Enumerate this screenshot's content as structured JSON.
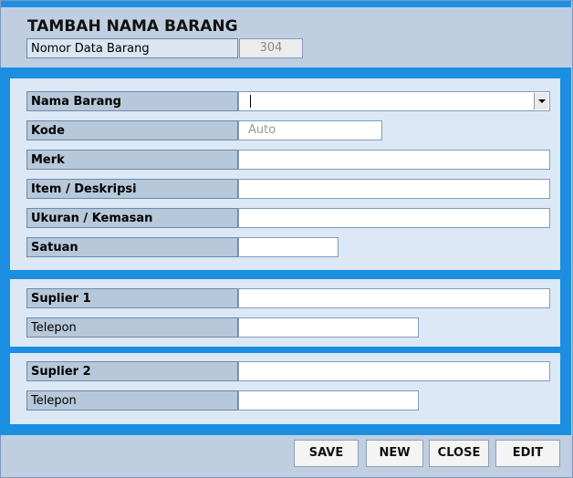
{
  "form": {
    "title": "TAMBAH NAMA BARANG",
    "nomor_label": "Nomor Data Barang",
    "nomor_value": "304"
  },
  "barang": {
    "nama_label": "Nama Barang",
    "nama_value": "",
    "kode_label": "Kode",
    "kode_placeholder": "Auto",
    "merk_label": "Merk",
    "item_label": "Item / Deskripsi",
    "ukuran_label": "Ukuran / Kemasan",
    "satuan_label": "Satuan"
  },
  "suplier1": {
    "label": "Suplier 1",
    "telepon_label": "Telepon"
  },
  "suplier2": {
    "label": "Suplier 2",
    "telepon_label": "Telepon"
  },
  "buttons": {
    "save": "SAVE",
    "new": "NEW",
    "close": "CLOSE",
    "edit": "EDIT"
  },
  "colors": {
    "accent": "#1c8fe2",
    "panel_bg": "#dce8f5",
    "label_bg": "#b7c8da"
  }
}
